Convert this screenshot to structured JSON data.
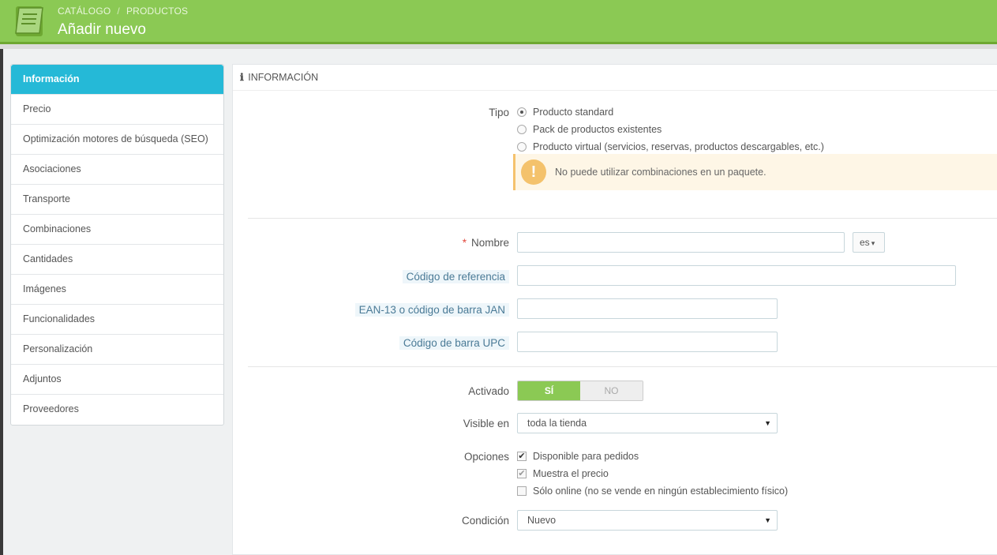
{
  "header": {
    "breadcrumb": [
      "CATÁLOGO",
      "PRODUCTOS"
    ],
    "breadcrumb_sep": "/",
    "title": "Añadir nuevo",
    "icon": "catalog-book-icon",
    "color": "#8bc954"
  },
  "sidebar": {
    "items": [
      {
        "label": "Información",
        "active": true
      },
      {
        "label": "Precio"
      },
      {
        "label": "Optimización motores de búsqueda (SEO)"
      },
      {
        "label": "Asociaciones"
      },
      {
        "label": "Transporte"
      },
      {
        "label": "Combinaciones"
      },
      {
        "label": "Cantidades"
      },
      {
        "label": "Imágenes"
      },
      {
        "label": "Funcionalidades"
      },
      {
        "label": "Personalización"
      },
      {
        "label": "Adjuntos"
      },
      {
        "label": "Proveedores"
      }
    ],
    "active_color": "#25b9d7"
  },
  "panel": {
    "heading_icon": "ℹ",
    "heading": "INFORMACIÓN"
  },
  "form": {
    "tipo_label": "Tipo",
    "tipo_options": [
      {
        "label": "Producto standard",
        "checked": true
      },
      {
        "label": "Pack de productos existentes",
        "checked": false
      },
      {
        "label": "Producto virtual (servicios, reservas, productos descargables, etc.)",
        "checked": false
      }
    ],
    "warning": {
      "icon": "!",
      "text": "No puede utilizar combinaciones en un paquete."
    },
    "nombre": {
      "required_mark": "*",
      "label": "Nombre",
      "value": ""
    },
    "lang": {
      "value": "es",
      "caret": "▾"
    },
    "referencia": {
      "label": "Código de referencia",
      "value": ""
    },
    "ean": {
      "label": "EAN-13 o código de barra JAN",
      "value": ""
    },
    "upc": {
      "label": "Código de barra UPC",
      "value": ""
    },
    "activado": {
      "label": "Activado",
      "on": "SÍ",
      "off": "NO",
      "value": "SÍ"
    },
    "visible": {
      "label": "Visible en",
      "value": "toda la tienda",
      "arrow": "▼"
    },
    "opciones": {
      "label": "Opciones",
      "items": [
        {
          "label": "Disponible para pedidos",
          "checked": true,
          "mark": "✔"
        },
        {
          "label": "Muestra el precio",
          "checked": true,
          "mark": "✔"
        },
        {
          "label": "Sólo online (no se vende en ningún establecimiento físico)",
          "checked": false,
          "mark": ""
        }
      ]
    },
    "condicion": {
      "label": "Condición",
      "value": "Nuevo",
      "arrow": "▼"
    }
  }
}
